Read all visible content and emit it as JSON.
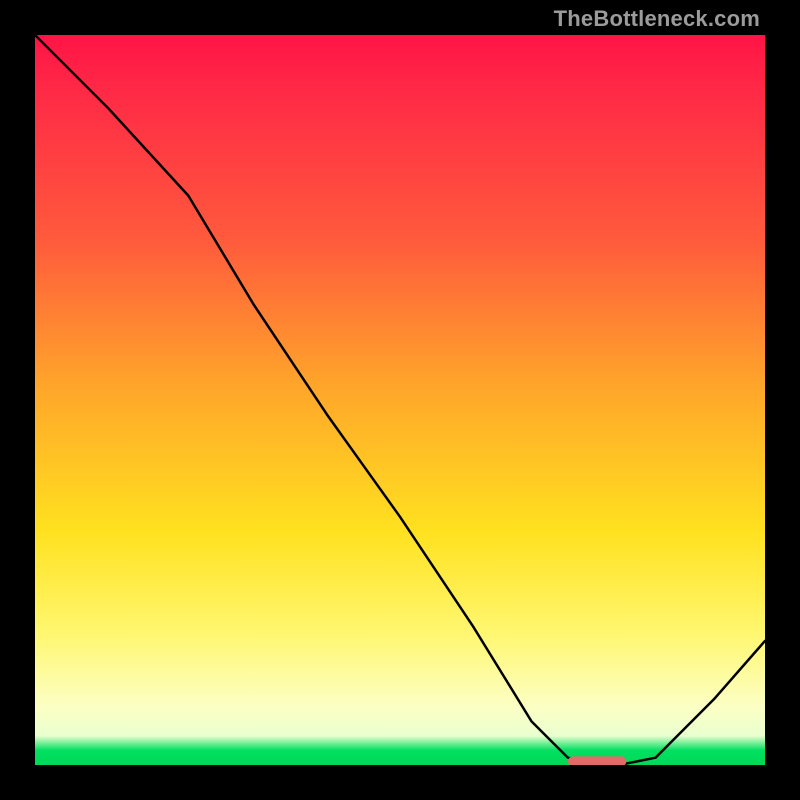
{
  "attribution": "TheBottleneck.com",
  "colors": {
    "top": "#ff1446",
    "mid_upper": "#ff5a3c",
    "mid": "#ffe11f",
    "mid_lower": "#fcffc4",
    "bottom": "#00d858",
    "curve": "#000000",
    "marker": "#e46a6a",
    "frame": "#000000",
    "attribution_text": "#9b9b9b"
  },
  "chart_data": {
    "type": "line",
    "title": "",
    "xlabel": "",
    "ylabel": "",
    "xlim": [
      0,
      100
    ],
    "ylim": [
      0,
      100
    ],
    "grid": false,
    "legend": false,
    "note": "Axes are unlabeled; x and y are inferred 0-100 percentage scales. y = bottleneck severity (0 = none/green bottom, 100 = max/red top).",
    "series": [
      {
        "name": "bottleneck-curve",
        "x": [
          0,
          10,
          21,
          30,
          40,
          50,
          60,
          68,
          73,
          78,
          80,
          85,
          93,
          100
        ],
        "y": [
          100,
          90,
          78,
          63,
          48,
          34,
          19,
          6,
          1,
          0,
          0,
          1,
          9,
          17
        ]
      }
    ],
    "marker": {
      "name": "optimal-range",
      "shape": "rounded-bar",
      "x_start": 73,
      "x_end": 81,
      "y": 0.5,
      "color": "#e46a6a"
    }
  }
}
